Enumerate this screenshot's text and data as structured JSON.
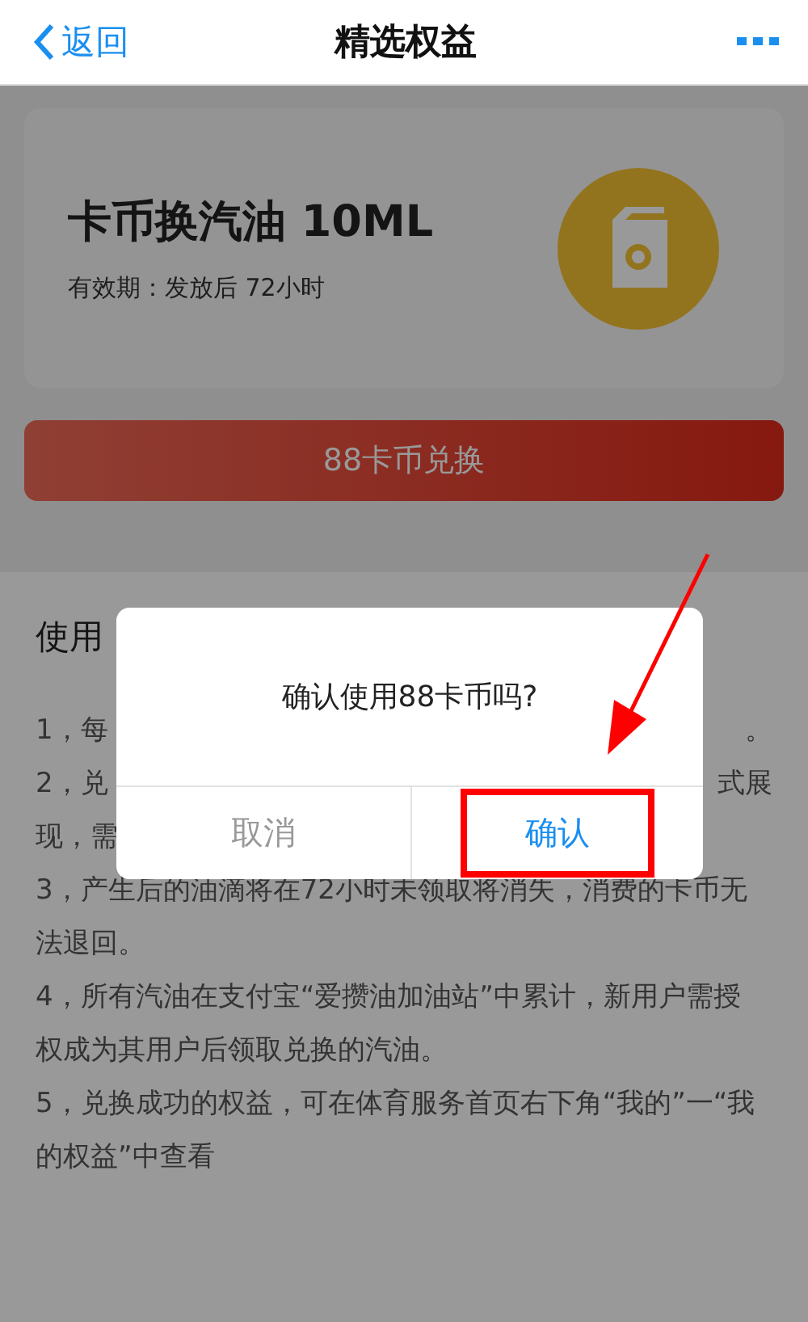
{
  "nav": {
    "back": "返回",
    "title": "精选权益"
  },
  "product": {
    "name": "卡币换汽油 10ML",
    "validity": "有效期：发放后 72小时"
  },
  "redeem_button": "88卡币兑换",
  "notes": {
    "heading": "使用",
    "lines": [
      {
        "kind": "split",
        "left": "1，每",
        "right": "。"
      },
      {
        "kind": "split",
        "left": "2，兑",
        "right": "式展"
      },
      {
        "kind": "split",
        "left": "现，需"
      },
      {
        "kind": "full",
        "text": "3，产生后的油滴将在72小时未领取将消失，消费的卡币无法退回。"
      },
      {
        "kind": "full",
        "text": "4，所有汽油在支付宝“爱攒油加油站”中累计，新用户需授权成为其用户后领取兑换的汽油。"
      },
      {
        "kind": "full",
        "text": "5，兑换成功的权益，可在体育服务首页右下角“我的”一“我的权益”中查看"
      }
    ]
  },
  "dialog": {
    "message": "确认使用88卡币吗?",
    "buttons": [
      {
        "kind": "cancel",
        "label": "取消",
        "highlighted": false
      },
      {
        "kind": "confirm",
        "label": "确认",
        "highlighted": true
      }
    ]
  }
}
